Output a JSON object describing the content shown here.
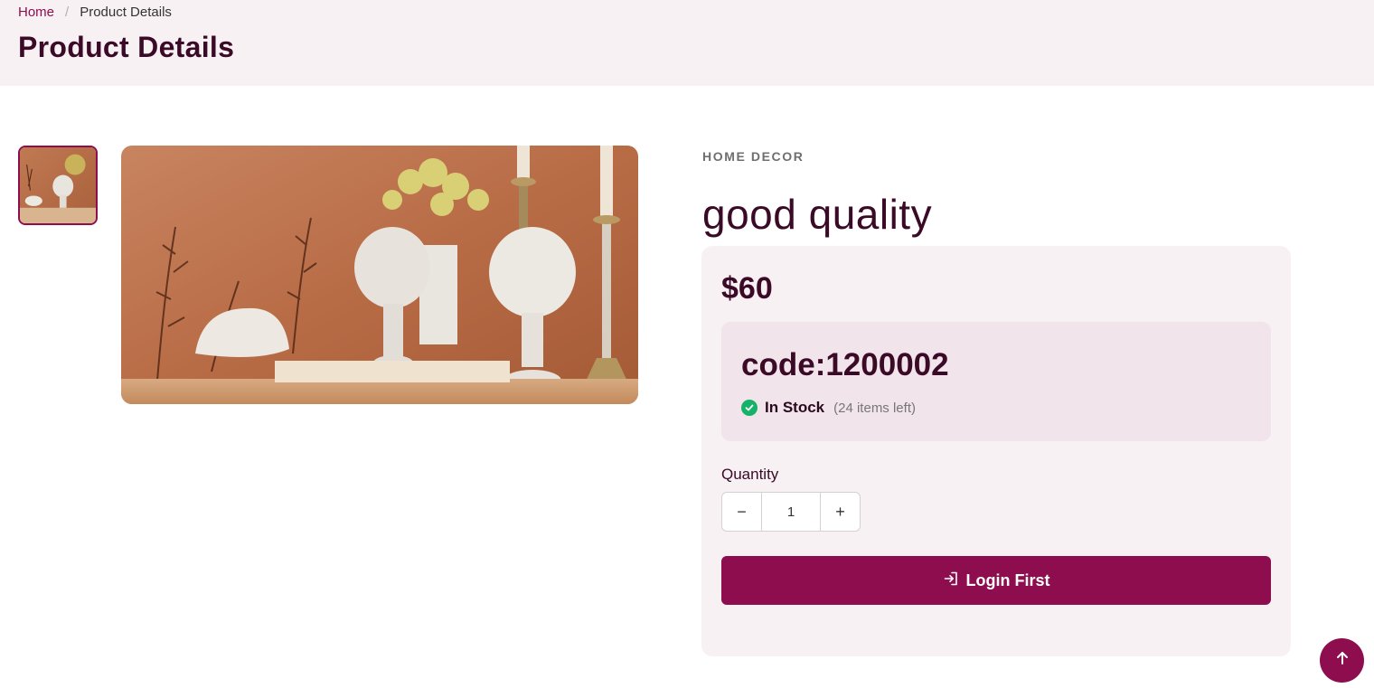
{
  "breadcrumb": {
    "home": "Home",
    "separator": "/",
    "current": "Product Details"
  },
  "page_title": "Product Details",
  "product": {
    "category": "HOME DECOR",
    "name": "good quality",
    "price": "$60",
    "code": "code:1200002",
    "stock_status": "In Stock",
    "stock_left": "(24 items left)"
  },
  "quantity": {
    "label": "Quantity",
    "value": "1",
    "minus": "−",
    "plus": "+"
  },
  "actions": {
    "login_label": "Login First"
  },
  "icons": {
    "stock": "check-circle-icon",
    "login": "login-icon",
    "scroll_top": "arrow-up-icon"
  },
  "colors": {
    "brand": "#8d0d4e",
    "header_bg": "#f7f1f4",
    "stock_green": "#17b26a",
    "title": "#3a0a26"
  }
}
